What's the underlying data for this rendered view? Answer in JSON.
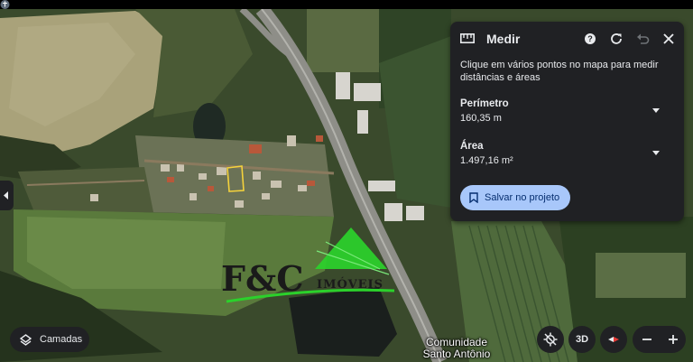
{
  "measure_panel": {
    "title": "Medir",
    "instruction": "Clique em vários pontos no mapa para medir distâncias e áreas",
    "perimeter_label": "Perímetro",
    "perimeter_value": "160,35 m",
    "area_label": "Área",
    "area_value": "1.497,16 m²",
    "save_label": "Salvar no projeto",
    "icons": [
      "ruler-icon",
      "help-icon",
      "refresh-icon",
      "undo-icon",
      "close-icon",
      "chevron-down-icon",
      "bookmark-icon"
    ]
  },
  "layers_button": {
    "label": "Camadas",
    "icon": "layers-icon"
  },
  "view_3d_label": "3D",
  "poi": {
    "line1": "Comunidade",
    "line2": "Santo Antônio",
    "icon": "church-pin-icon"
  },
  "watermark": {
    "brand": "F&C",
    "tagline": "IMÓVEIS"
  },
  "colors": {
    "panel_bg": "#202124",
    "panel_text": "#e8eaed",
    "save_button_bg": "#a8c7fa",
    "save_button_text": "#062e6f",
    "measure_outline": "#f4d23c"
  }
}
